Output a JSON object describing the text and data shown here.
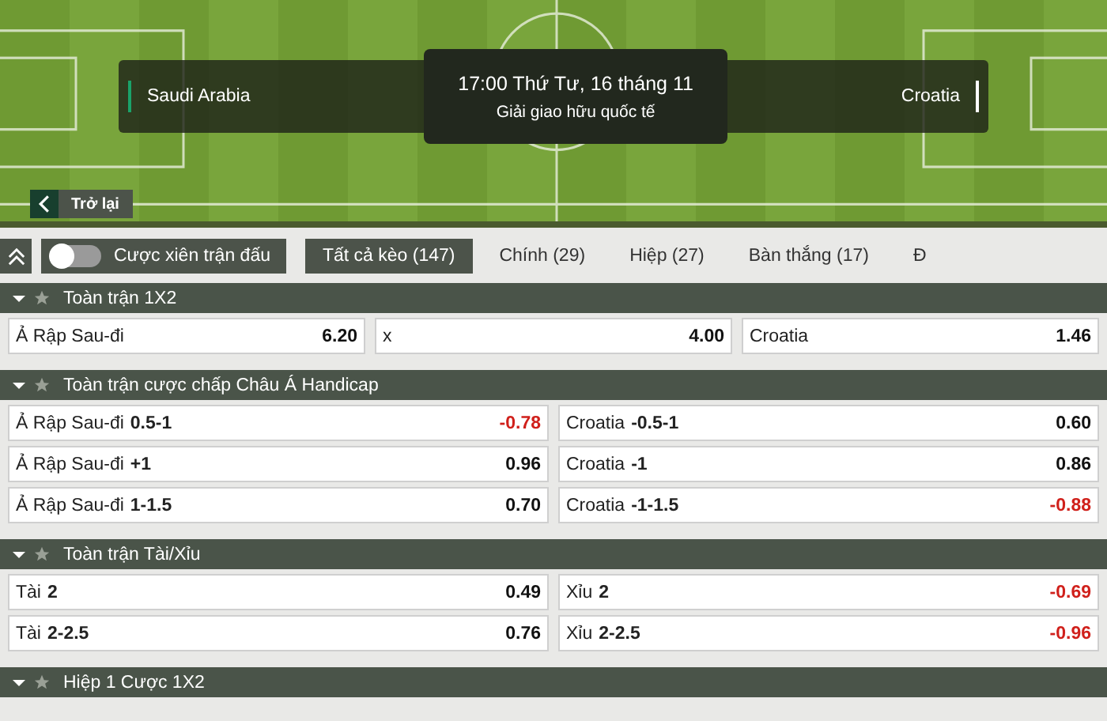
{
  "match": {
    "home": "Saudi Arabia",
    "away": "Croatia",
    "time": "17:00 Thứ Tư, 16 tháng 11",
    "league": "Giải giao hữu quốc tế"
  },
  "back_button": {
    "label": "Trở lại"
  },
  "parlay_toggle": {
    "label": "Cược xiên trận đấu",
    "on": false
  },
  "tabs": [
    {
      "label": "Tất cả kèo (147)",
      "selected": true
    },
    {
      "label": "Chính (29)",
      "selected": false
    },
    {
      "label": "Hiệp (27)",
      "selected": false
    },
    {
      "label": "Bàn thắng (17)",
      "selected": false
    },
    {
      "label": "Đ",
      "selected": false
    }
  ],
  "markets": [
    {
      "title": "Toàn trận 1X2",
      "kind": "three-way",
      "expanded": true,
      "selections": [
        {
          "label": "Ả Rập Sau-đi",
          "odds": "6.20",
          "negative": false
        },
        {
          "label": "x",
          "odds": "4.00",
          "negative": false
        },
        {
          "label": "Croatia",
          "odds": "1.46",
          "negative": false
        }
      ]
    },
    {
      "title": "Toàn trận cược chấp Châu Á Handicap",
      "kind": "two-way",
      "expanded": true,
      "selections": [
        {
          "label": "Ả Rập Sau-đi",
          "line": "0.5-1",
          "odds": "-0.78",
          "negative": true
        },
        {
          "label": "Croatia",
          "line": "-0.5-1",
          "odds": "0.60",
          "negative": false
        },
        {
          "label": "Ả Rập Sau-đi",
          "line": "+1",
          "odds": "0.96",
          "negative": false
        },
        {
          "label": "Croatia",
          "line": "-1",
          "odds": "0.86",
          "negative": false
        },
        {
          "label": "Ả Rập Sau-đi",
          "line": "1-1.5",
          "odds": "0.70",
          "negative": false
        },
        {
          "label": "Croatia",
          "line": "-1-1.5",
          "odds": "-0.88",
          "negative": true
        }
      ]
    },
    {
      "title": "Toàn trận Tài/Xỉu",
      "kind": "two-way",
      "expanded": true,
      "selections": [
        {
          "label": "Tài",
          "line": "2",
          "odds": "0.49",
          "negative": false
        },
        {
          "label": "Xỉu",
          "line": "2",
          "odds": "-0.69",
          "negative": true
        },
        {
          "label": "Tài",
          "line": "2-2.5",
          "odds": "0.76",
          "negative": false
        },
        {
          "label": "Xỉu",
          "line": "2-2.5",
          "odds": "-0.96",
          "negative": true
        }
      ]
    },
    {
      "title": "Hiệp 1 Cược 1X2",
      "expanded": true
    }
  ]
}
